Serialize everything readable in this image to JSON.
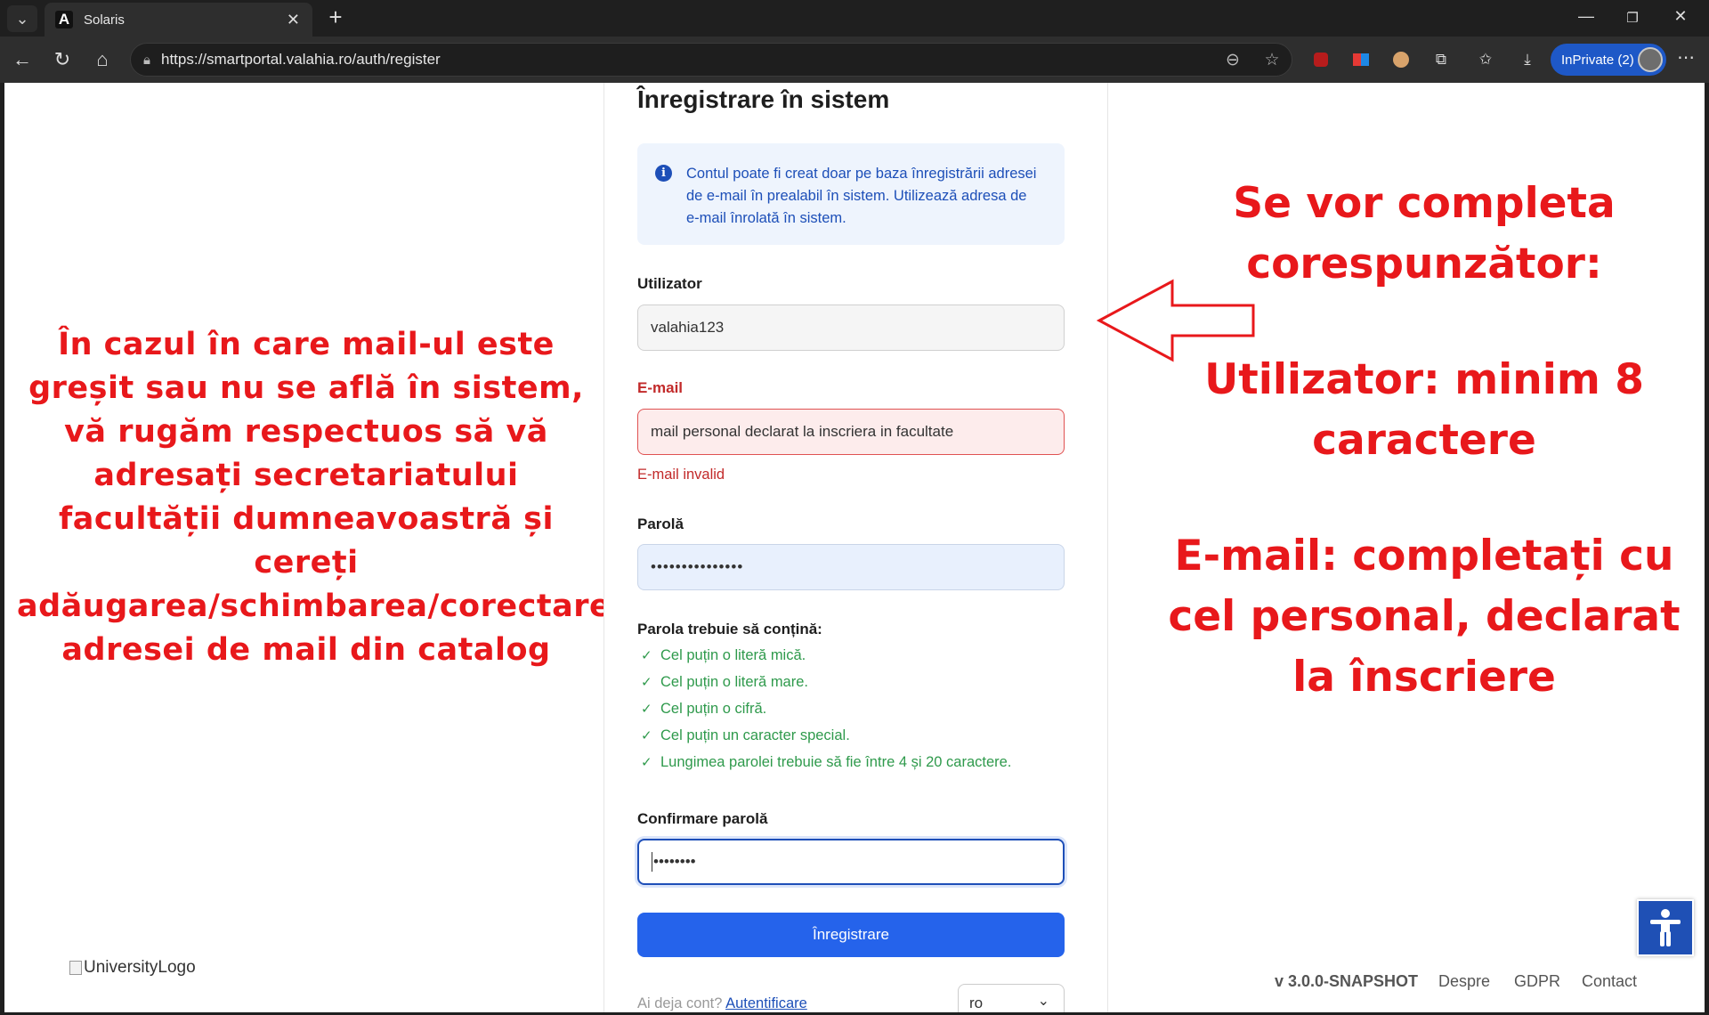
{
  "browser": {
    "tab_title": "Solaris",
    "tab_favicon": "A",
    "url": "https://smartportal.valahia.ro/auth/register",
    "inprivate_label": "InPrivate (2)"
  },
  "form": {
    "title": "Înregistrare în sistem",
    "info": "Contul poate fi creat doar pe baza înregistrării adresei de e-mail în prealabil în sistem. Utilizează adresa de e-mail înrolată în sistem.",
    "username_label": "Utilizator",
    "username_value": "valahia123",
    "email_label": "E-mail",
    "email_value": "mail personal declarat la inscriera in facultate",
    "email_error": "E-mail invalid",
    "password_label": "Parolă",
    "password_value": "•••••••••••••••",
    "requirements_title": "Parola trebuie să conțină:",
    "requirements": [
      "Cel puțin o literă mică.",
      "Cel puțin o literă mare.",
      "Cel puțin o cifră.",
      "Cel puțin un caracter special.",
      "Lungimea parolei trebuie să fie între 4 și 20 caractere."
    ],
    "confirm_label": "Confirmare parolă",
    "confirm_value": "••••••••",
    "submit_label": "Înregistrare",
    "have_account": "Ai deja cont?",
    "login_link": "Autentificare",
    "language": "ro"
  },
  "annotations": {
    "left": "În cazul în care mail-ul este greșit sau nu se află în sistem, vă rugăm respectuos să vă adresați secretariatului facultății dumneavoastră și cereți adăugarea/schimbarea/corectarea adresei de mail din catalog",
    "right_1": "Se vor completa corespunzător:",
    "right_2": "Utilizator: minim 8 caractere",
    "right_3": "E-mail: completați cu cel personal, declarat la înscriere"
  },
  "footer": {
    "logo_alt": "UniversityLogo",
    "version": "v 3.0.0-SNAPSHOT",
    "about": "Despre",
    "gdpr": "GDPR",
    "contact": "Contact"
  },
  "colors": {
    "accent": "#2563eb",
    "annotation": "#e8181b",
    "error": "#c22a2a",
    "success": "#2f9a4c"
  },
  "icons": {
    "info": "info-icon",
    "accessibility": "accessibility-icon"
  }
}
